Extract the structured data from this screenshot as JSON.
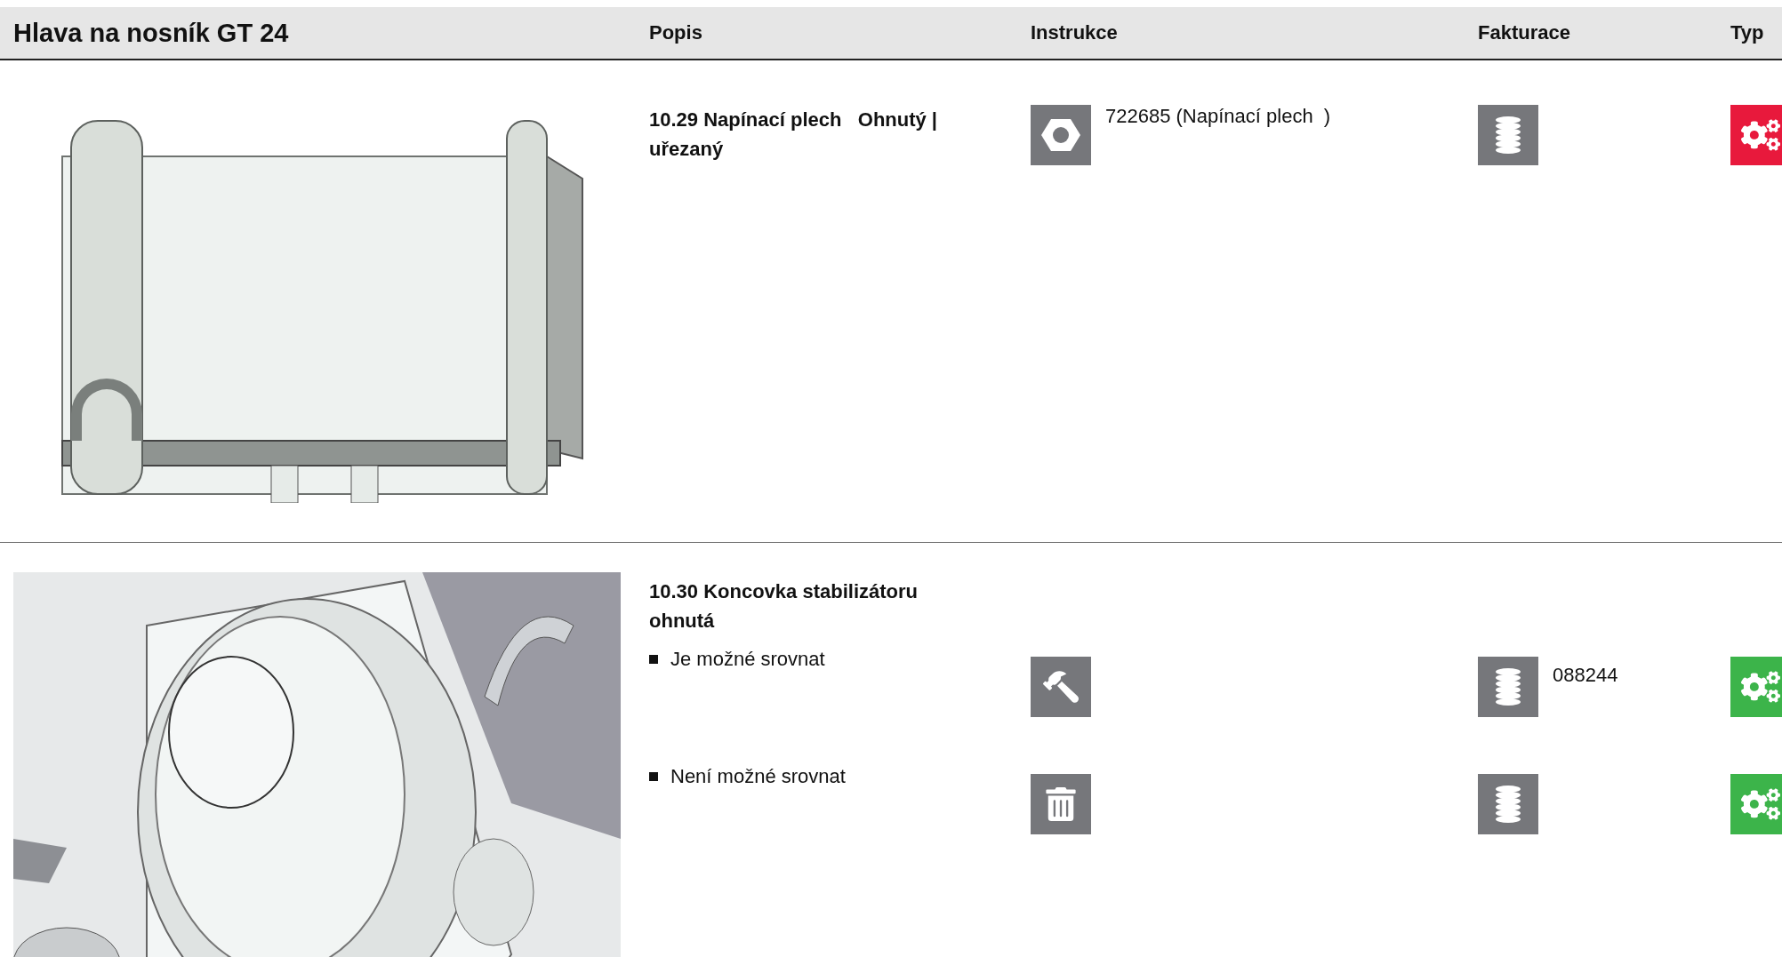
{
  "header": {
    "title": "Hlava na nosník GT 24",
    "columns": [
      "Popis",
      "Instrukce",
      "Fakturace",
      "Typ"
    ]
  },
  "items": [
    {
      "image": {
        "kind": "picture"
      },
      "title": "10.29 Napínací plech   Ohnutý | uřezaný",
      "rows": [
        {
          "instruction": {
            "kind": "nut",
            "text": "722685 (Napínací plech  )"
          },
          "billing": {
            "kind": "coins"
          },
          "type": {
            "color": "#e8193c"
          }
        }
      ]
    },
    {
      "image": {
        "kind": "picture"
      },
      "title": "10.30 Koncovka stabilizátoru ohnutá",
      "rows": [
        {
          "bullet": "Je možné srovnat",
          "instruction": {
            "kind": "hammer"
          },
          "billing": {
            "kind": "coins",
            "text": "088244"
          },
          "type": {
            "color": "#3cb44a"
          }
        },
        {
          "bullet": "Není možné srovnat",
          "instruction": {
            "kind": "trash"
          },
          "billing": {
            "kind": "coins"
          },
          "type": {
            "color": "#3cb44a"
          }
        }
      ]
    }
  ]
}
